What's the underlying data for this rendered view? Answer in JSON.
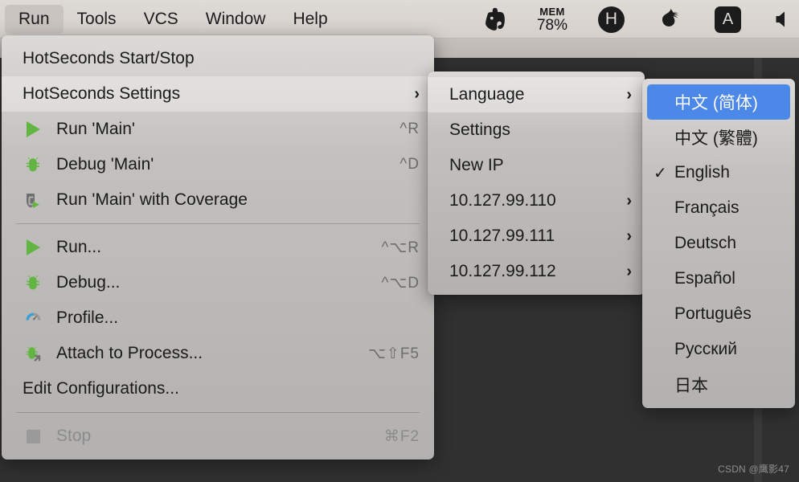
{
  "menubar": {
    "items": [
      {
        "label": "Run",
        "active": true
      },
      {
        "label": "Tools",
        "active": false
      },
      {
        "label": "VCS",
        "active": false
      },
      {
        "label": "Window",
        "active": false
      },
      {
        "label": "Help",
        "active": false
      }
    ],
    "status_icons": [
      {
        "name": "evernote-icon",
        "glyph": "🐘"
      },
      {
        "name": "memory-usage-icon",
        "label": "MEM",
        "value": "78%"
      },
      {
        "name": "h-circle-icon",
        "glyph": "H"
      },
      {
        "name": "comet-icon",
        "glyph": "☄"
      },
      {
        "name": "a-square-icon",
        "glyph": "A"
      },
      {
        "name": "volume-icon",
        "glyph": "🔈"
      }
    ]
  },
  "run_menu": {
    "items": [
      {
        "label": "HotSeconds Start/Stop",
        "shortcut": "",
        "icon": "",
        "arrow": false,
        "highlight": false,
        "disabled": false
      },
      {
        "label": "HotSeconds Settings",
        "shortcut": "",
        "icon": "",
        "arrow": true,
        "highlight": true,
        "disabled": false
      },
      {
        "label": "Run 'Main'",
        "shortcut": "^R",
        "icon": "play",
        "arrow": false,
        "highlight": false,
        "disabled": false
      },
      {
        "label": "Debug 'Main'",
        "shortcut": "^D",
        "icon": "bug",
        "arrow": false,
        "highlight": false,
        "disabled": false
      },
      {
        "label": "Run 'Main' with Coverage",
        "shortcut": "",
        "icon": "coverage",
        "arrow": false,
        "highlight": false,
        "disabled": false
      },
      {
        "separator": true
      },
      {
        "label": "Run...",
        "shortcut": "^⌥R",
        "icon": "play",
        "arrow": false,
        "highlight": false,
        "disabled": false
      },
      {
        "label": "Debug...",
        "shortcut": "^⌥D",
        "icon": "bug",
        "arrow": false,
        "highlight": false,
        "disabled": false
      },
      {
        "label": "Profile...",
        "shortcut": "",
        "icon": "profile",
        "arrow": false,
        "highlight": false,
        "disabled": false
      },
      {
        "label": "Attach to Process...",
        "shortcut": "⌥⇧F5",
        "icon": "attach",
        "arrow": false,
        "highlight": false,
        "disabled": false
      },
      {
        "label": "Edit Configurations...",
        "shortcut": "",
        "icon": "",
        "arrow": false,
        "highlight": false,
        "disabled": false
      },
      {
        "separator": true
      },
      {
        "label": "Stop",
        "shortcut": "⌘F2",
        "icon": "stop",
        "arrow": false,
        "highlight": false,
        "disabled": true
      }
    ]
  },
  "hotseconds_submenu": {
    "items": [
      {
        "label": "Language",
        "arrow": true,
        "highlight": true
      },
      {
        "label": "Settings",
        "arrow": false,
        "highlight": false
      },
      {
        "label": "New IP",
        "arrow": false,
        "highlight": false
      },
      {
        "label": "10.127.99.110",
        "arrow": true,
        "highlight": false
      },
      {
        "label": "10.127.99.111",
        "arrow": true,
        "highlight": false
      },
      {
        "label": "10.127.99.112",
        "arrow": true,
        "highlight": false
      }
    ]
  },
  "language_submenu": {
    "items": [
      {
        "label": "中文 (简体)",
        "checked": false,
        "selected": true
      },
      {
        "label": "中文 (繁體)",
        "checked": false,
        "selected": false
      },
      {
        "label": "English",
        "checked": true,
        "selected": false
      },
      {
        "label": "Français",
        "checked": false,
        "selected": false
      },
      {
        "label": "Deutsch",
        "checked": false,
        "selected": false
      },
      {
        "label": "Español",
        "checked": false,
        "selected": false
      },
      {
        "label": "Português",
        "checked": false,
        "selected": false
      },
      {
        "label": "Русский",
        "checked": false,
        "selected": false
      },
      {
        "label": "日本",
        "checked": false,
        "selected": false
      }
    ]
  },
  "watermark": {
    "text": "CSDN @鹰影47"
  },
  "colors": {
    "selection_blue": "#4b88e8",
    "menu_bg": "#c3c1be",
    "menubar_bg": "#dedad6",
    "ide_bg": "#2b2b2b",
    "accent_green": "#62b543",
    "profile_blue": "#389fd6"
  }
}
